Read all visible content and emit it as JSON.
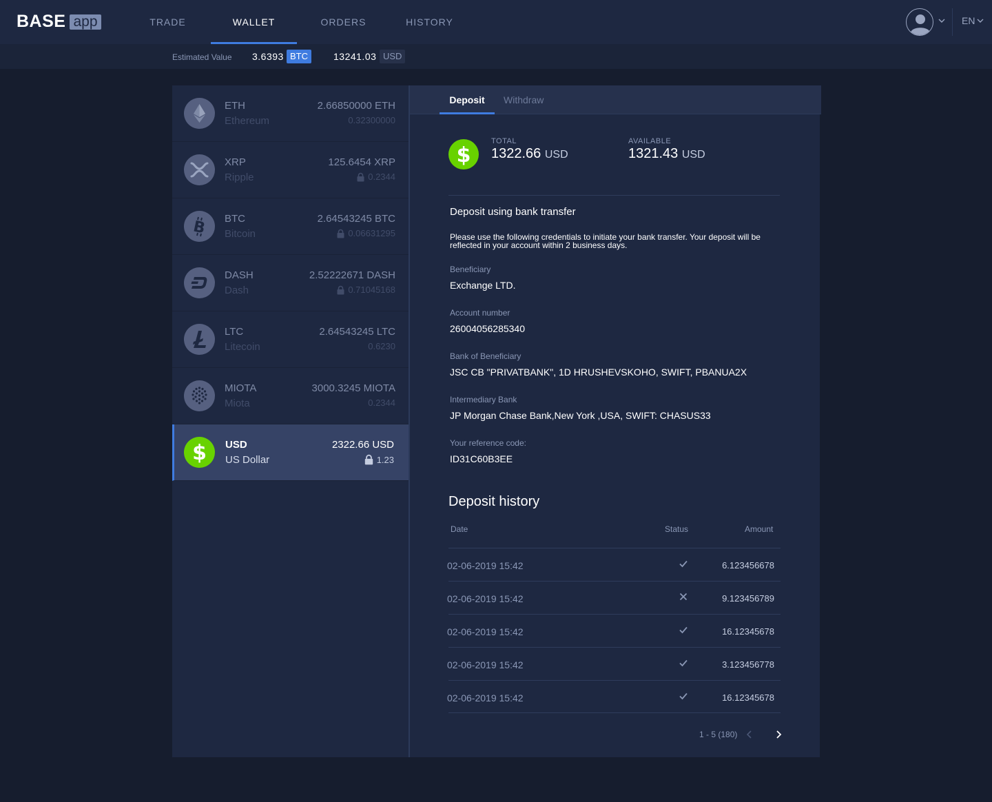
{
  "header": {
    "logo_base": "BASE",
    "logo_app": "app",
    "nav": [
      {
        "label": "TRADE"
      },
      {
        "label": "WALLET"
      },
      {
        "label": "ORDERS"
      },
      {
        "label": "HISTORY"
      }
    ],
    "active_nav": "WALLET",
    "language": "EN"
  },
  "estimate": {
    "label": "Estimated Value",
    "btc_value": "3.6393",
    "btc_unit": "BTC",
    "usd_value": "13241.03",
    "usd_unit": "USD"
  },
  "assets": [
    {
      "symbol": "ETH",
      "name": "Ethereum",
      "balance": "2.66850000 ETH",
      "locked": "0.32300000",
      "icon": "ethereum-icon",
      "has_lock": false
    },
    {
      "symbol": "XRP",
      "name": "Ripple",
      "balance": "125.6454 XRP",
      "locked": "0.2344",
      "icon": "ripple-icon",
      "has_lock": true
    },
    {
      "symbol": "BTC",
      "name": "Bitcoin",
      "balance": "2.64543245 BTC",
      "locked": "0.06631295",
      "icon": "bitcoin-icon",
      "has_lock": true
    },
    {
      "symbol": "DASH",
      "name": "Dash",
      "balance": "2.52222671 DASH",
      "locked": "0.71045168",
      "icon": "dash-icon",
      "has_lock": true
    },
    {
      "symbol": "LTC",
      "name": "Litecoin",
      "balance": "2.64543245 LTC",
      "locked": "0.6230",
      "icon": "litecoin-icon",
      "has_lock": false
    },
    {
      "symbol": "MIOTA",
      "name": "Miota",
      "balance": "3000.3245 MIOTA",
      "locked": "0.2344",
      "icon": "iota-icon",
      "has_lock": false
    },
    {
      "symbol": "USD",
      "name": "US Dollar",
      "balance": "2322.66 USD",
      "locked": "1.23",
      "icon": "dollar-icon",
      "has_lock": true,
      "selected": true
    }
  ],
  "tabs": {
    "deposit": "Deposit",
    "withdraw": "Withdraw",
    "active": "Deposit"
  },
  "balance": {
    "total_label": "TOTAL",
    "total_value": "1322.66",
    "total_unit": "USD",
    "available_label": "AVAILABLE",
    "available_value": "1321.43",
    "available_unit": "USD"
  },
  "deposit": {
    "title": "Deposit using bank transfer",
    "description": "Please use the following credentials to initiate your bank transfer. Your deposit will be reflected in your account within 2 business days.",
    "fields": [
      {
        "label": "Beneficiary",
        "value": "Exchange LTD."
      },
      {
        "label": "Account number",
        "value": "26004056285340"
      },
      {
        "label": "Bank of Beneficiary",
        "value": "JSC CB \"PRIVATBANK\", 1D HRUSHEVSKOHO, SWIFT, PBANUA2X"
      },
      {
        "label": "Intermediary Bank",
        "value": "JP Morgan Chase Bank,New York ,USA, SWIFT: CHASUS33"
      },
      {
        "label": "Your reference code:",
        "value": "ID31C60B3EE"
      }
    ]
  },
  "history": {
    "title": "Deposit history",
    "columns": {
      "date": "Date",
      "status": "Status",
      "amount": "Amount"
    },
    "rows": [
      {
        "date": "02-06-2019 15:42",
        "status": "success",
        "amount": "6.123456678"
      },
      {
        "date": "02-06-2019 15:42",
        "status": "failed",
        "amount": "9.123456789"
      },
      {
        "date": "02-06-2019 15:42",
        "status": "success",
        "amount": "16.12345678"
      },
      {
        "date": "02-06-2019 15:42",
        "status": "success",
        "amount": "3.123456778"
      },
      {
        "date": "02-06-2019 15:42",
        "status": "success",
        "amount": "16.12345678"
      }
    ],
    "pagination": "1 - 5 (180)"
  },
  "colors": {
    "accent": "#3f7ce0",
    "success_green": "#68d200",
    "panel": "#1e2841",
    "background": "#161d2e"
  }
}
